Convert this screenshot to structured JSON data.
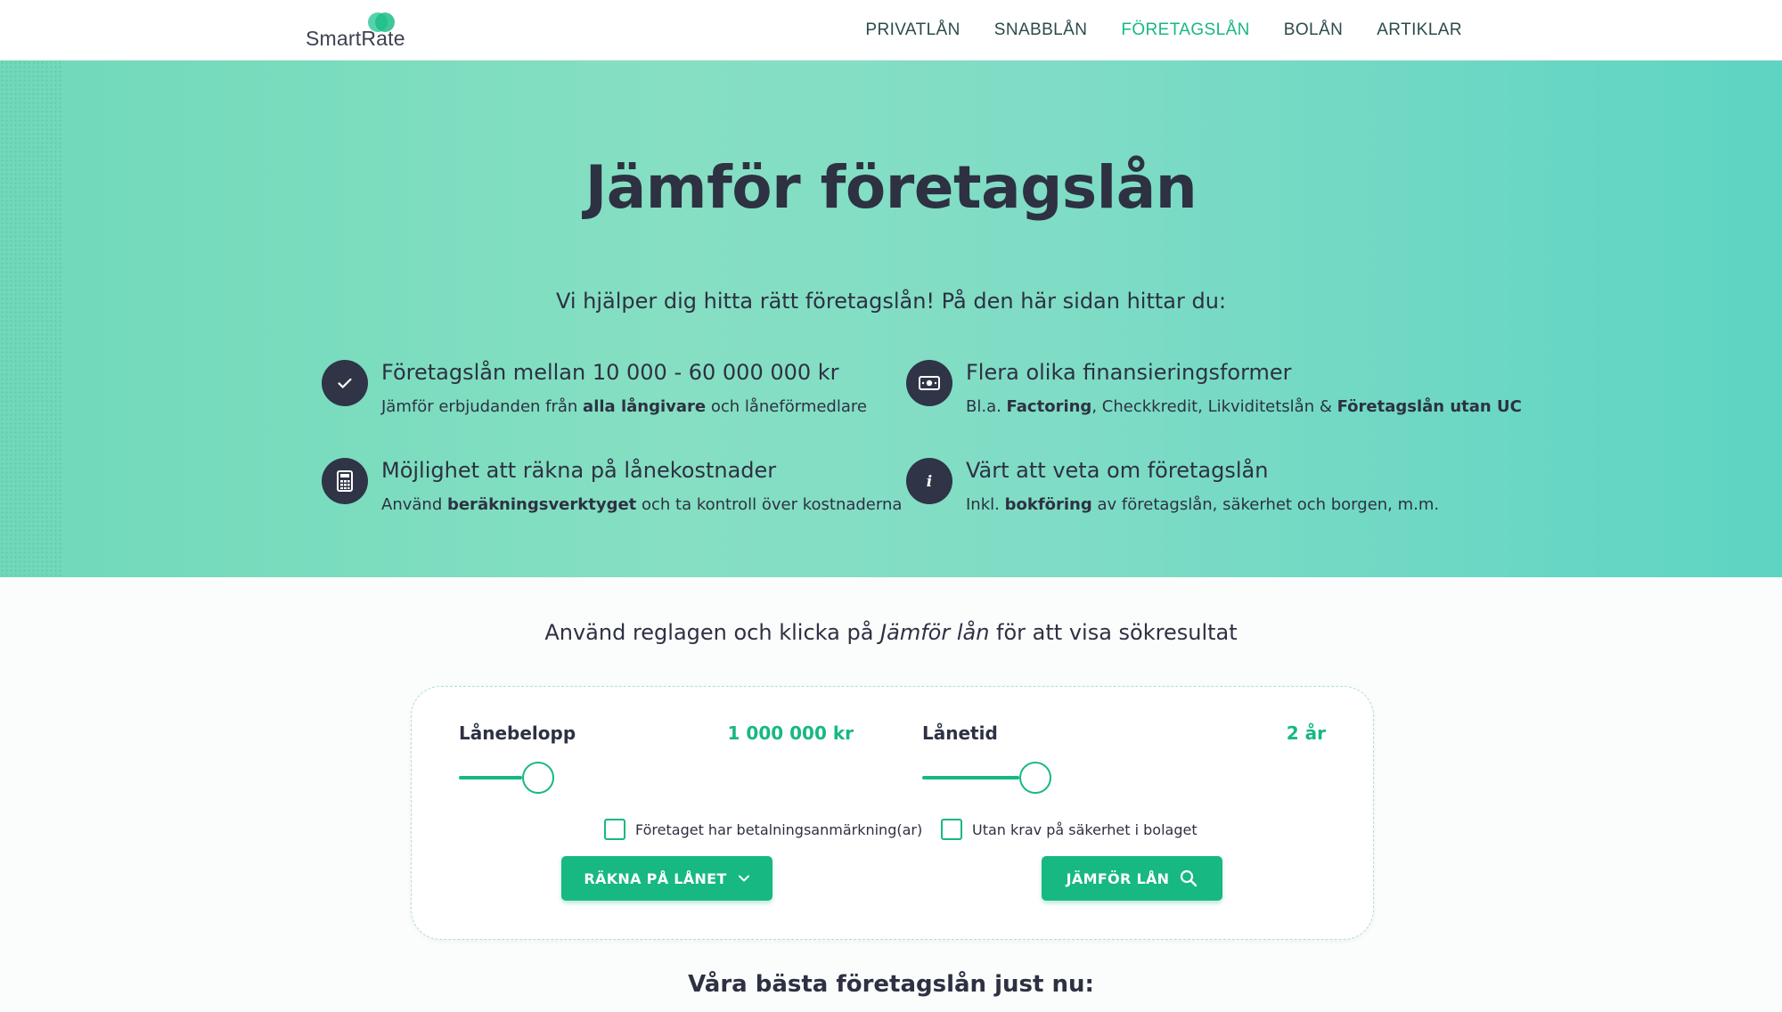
{
  "brand": {
    "name": "SmartRate"
  },
  "nav": {
    "items": [
      {
        "label": "PRIVATLÅN",
        "active": false
      },
      {
        "label": "SNABBLÅN",
        "active": false
      },
      {
        "label": "FÖRETAGSLÅN",
        "active": true
      },
      {
        "label": "BOLÅN",
        "active": false
      },
      {
        "label": "ARTIKLAR",
        "active": false
      }
    ]
  },
  "hero": {
    "title": "Jämför företagslån",
    "subtitle": "Vi hjälper dig hitta rätt företagslån! På den här sidan hittar du:",
    "features": [
      {
        "icon": "check-icon",
        "title": "Företagslån mellan 10 000 - 60 000 000 kr",
        "desc": [
          "Jämför erbjudanden från ",
          "alla långivare",
          " och låneförmedlare"
        ]
      },
      {
        "icon": "money-icon",
        "title": "Flera olika finansieringsformer",
        "desc": [
          "Bl.a. ",
          "Factoring",
          ", Checkkredit, Likviditetslån & ",
          "Företagslån utan UC",
          ""
        ]
      },
      {
        "icon": "calculator-icon",
        "title": "Möjlighet att räkna på lånekostnader",
        "desc": [
          "Använd ",
          "beräkningsverktyget",
          " och ta kontroll över kostnaderna"
        ]
      },
      {
        "icon": "info-icon",
        "title": "Värt att veta om företagslån",
        "desc": [
          "Inkl. ",
          "bokföring",
          " av företagslån, säkerhet och borgen, m.m."
        ]
      }
    ]
  },
  "instruction": {
    "before": "Använd reglagen och klicka på ",
    "em": "Jämför lån",
    "after": " för att visa sökresultat"
  },
  "calculator": {
    "amount_label": "Lånebelopp",
    "amount_value": "1 000 000 kr",
    "amount_fill": 0.16,
    "term_label": "Lånetid",
    "term_value": "2 år",
    "term_fill": 0.24,
    "check_remarks": "Företaget har betalningsanmärkning(ar)",
    "check_remarks_checked": false,
    "check_security": "Utan krav på säkerhet i bolaget",
    "check_security_checked": false,
    "calc_button": "RÄKNA PÅ LÅNET",
    "compare_button": "JÄMFÖR LÅN"
  },
  "best_heading": "Våra bästa företagslån just nu:",
  "colors": {
    "accent": "#17b882",
    "dark": "#2d3142"
  }
}
